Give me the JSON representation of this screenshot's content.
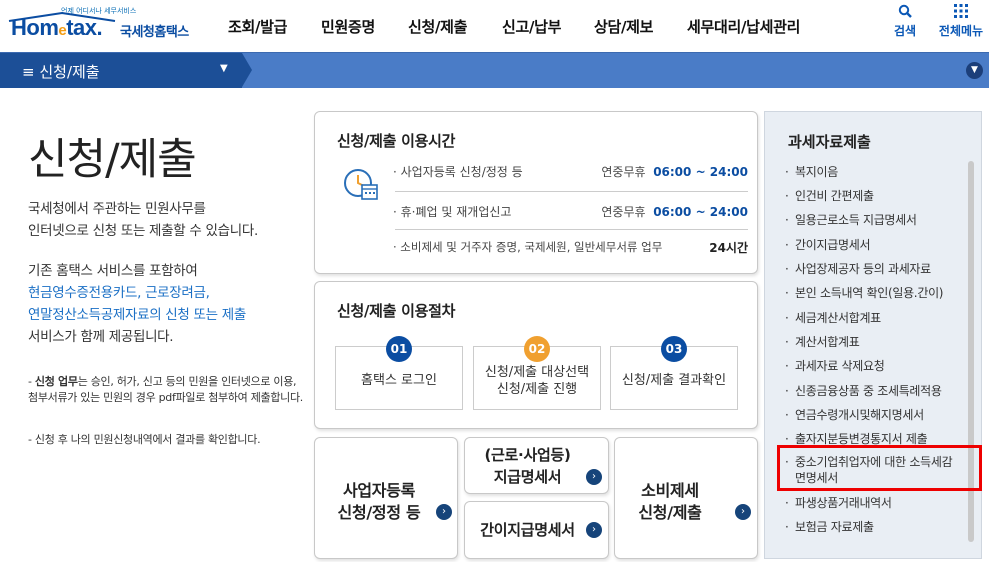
{
  "header": {
    "logo_tagline": "언제 어디서나 세무서비스",
    "logo_word_1": "Hom",
    "logo_word_e": "e",
    "logo_word_2": "tax.",
    "logo_kr": "국세청홈택스",
    "nav": [
      "조회/발급",
      "민원증명",
      "신청/제출",
      "신고/납부",
      "상담/제보",
      "세무대리/납세관리"
    ],
    "search_label": "검색",
    "menu_label": "전체메뉴"
  },
  "bar": {
    "title": "신청/제출"
  },
  "intro": {
    "title": "신청/제출",
    "p1": [
      "국세청에서 주관하는 민원사무를",
      "인터넷으로 신청 또는 제출할 수 있습니다."
    ],
    "p2_first": "기존 홈택스 서비스를 포함하여",
    "p2_blue": [
      "현금영수증전용카드, 근로장려금,",
      "연말정산소득공제자료의 신청 또는 제출"
    ],
    "p2_last": "서비스가 함께 제공됩니다.",
    "note1_bold": "신청 업무",
    "note1_rest": "는 승인, 허가, 신고 등의 민원을 인터넷으로 이용, 첨부서류가 있는 민원의 경우 pdf파일로 첨부하여 제출합니다.",
    "note2": "신청 후 나의 민원신청내역에서 결과를 확인합니다."
  },
  "hours": {
    "title": "신청/제출 이용시간",
    "rows": [
      {
        "name": "· 사업자등록 신청/정정 등",
        "label": "연중무휴",
        "time": "06:00 ~ 24:00"
      },
      {
        "name": "· 휴·폐업 및 재개업신고",
        "label": "연중무휴",
        "time": "06:00 ~ 24:00"
      },
      {
        "name": "· 소비제세 및 거주자 증명, 국제세원, 일반세무서류 업무",
        "label": "",
        "time": "24시간"
      }
    ]
  },
  "procedure": {
    "title": "신청/제출 이용절차",
    "steps": [
      {
        "num": "01",
        "l1": "홈택스 로그인",
        "l2": ""
      },
      {
        "num": "02",
        "l1": "신청/제출 대상선택",
        "l2": "신청/제출 진행"
      },
      {
        "num": "03",
        "l1": "신청/제출 결과확인",
        "l2": ""
      }
    ]
  },
  "shortcuts": {
    "biz_l1": "사업자등록",
    "biz_l2": "신청/정정 등",
    "wage_l1": "(근로·사업등)",
    "wage_l2": "지급명세서",
    "simple": "간이지급명세서",
    "consume_l1": "소비제세",
    "consume_l2": "신청/제출"
  },
  "tax_data": {
    "title": "과세자료제출",
    "items": [
      "복지이음",
      "인건비 간편제출",
      "일용근로소득 지급명세서",
      "간이지급명세서",
      "사업장제공자 등의 과세자료",
      "본인 소득내역 확인(일용.간이)",
      "세금계산서합계표",
      "계산서합계표",
      "과세자료 삭제요청",
      "신종금융상품 중 조세특례적용",
      "연금수령개시및해지명세서",
      "출자지분등변경통지서 제출",
      "중소기업취업자에 대한 소득세감",
      "면명세서",
      "파생상품거래내역서",
      "보험금 자료제출"
    ]
  },
  "colors": {
    "brand": "#0b4da2",
    "bar": "#4a7cc7",
    "bar_dark": "#1c4f97",
    "highlight": "#e00000",
    "step_accent": "#f0a030"
  }
}
